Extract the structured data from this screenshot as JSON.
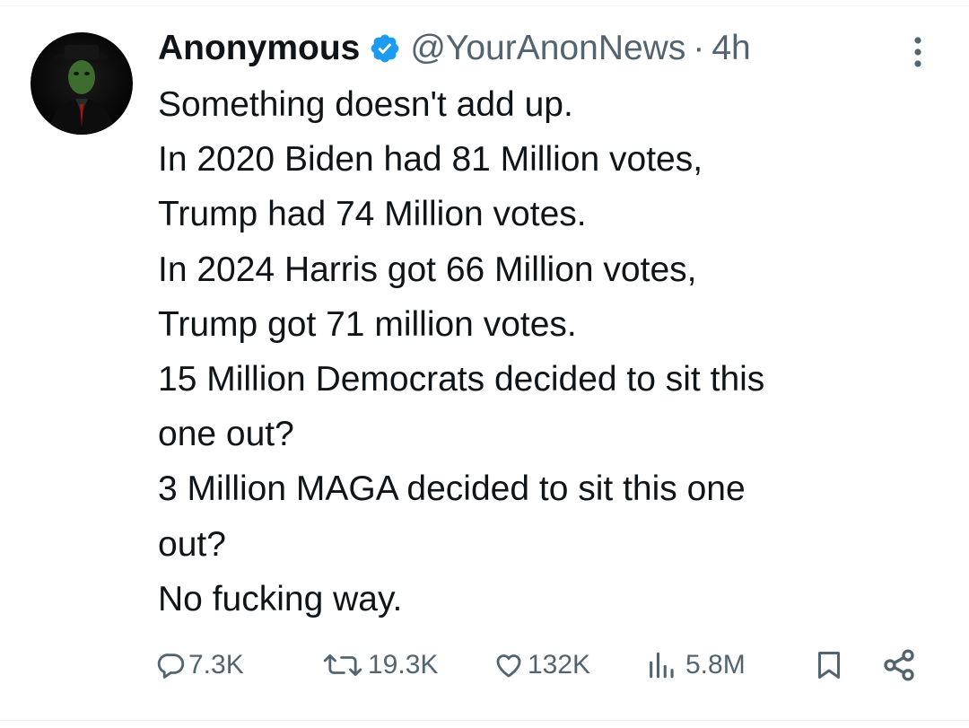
{
  "tweet": {
    "author": {
      "display_name": "Anonymous",
      "handle": "@YourAnonNews",
      "verified": true,
      "avatar_icon": "masked-figure-avatar"
    },
    "separator": "·",
    "time": "4h",
    "text_lines": [
      "Something doesn't add up.",
      "In 2020 Biden had 81 Million votes,",
      "Trump had 74 Million votes.",
      "In 2024 Harris got 66 Million votes,",
      "Trump got 71 million votes.",
      "15 Million Democrats decided to sit this",
      "one out?",
      "3 Million MAGA decided to sit this one",
      "out?",
      "No fucking way."
    ],
    "actions": {
      "replies": "7.3K",
      "reposts": "19.3K",
      "likes": "132K",
      "views": "5.8M"
    }
  },
  "colors": {
    "text": "#0f1419",
    "secondary": "#536471",
    "verified_blue": "#1d9bf0",
    "divider": "#eff3f4"
  },
  "icons": {
    "verified": "verified-badge-icon",
    "more": "more-options-icon",
    "reply": "reply-icon",
    "repost": "repost-icon",
    "like": "like-icon",
    "views": "views-icon",
    "bookmark": "bookmark-icon",
    "share": "share-icon"
  }
}
